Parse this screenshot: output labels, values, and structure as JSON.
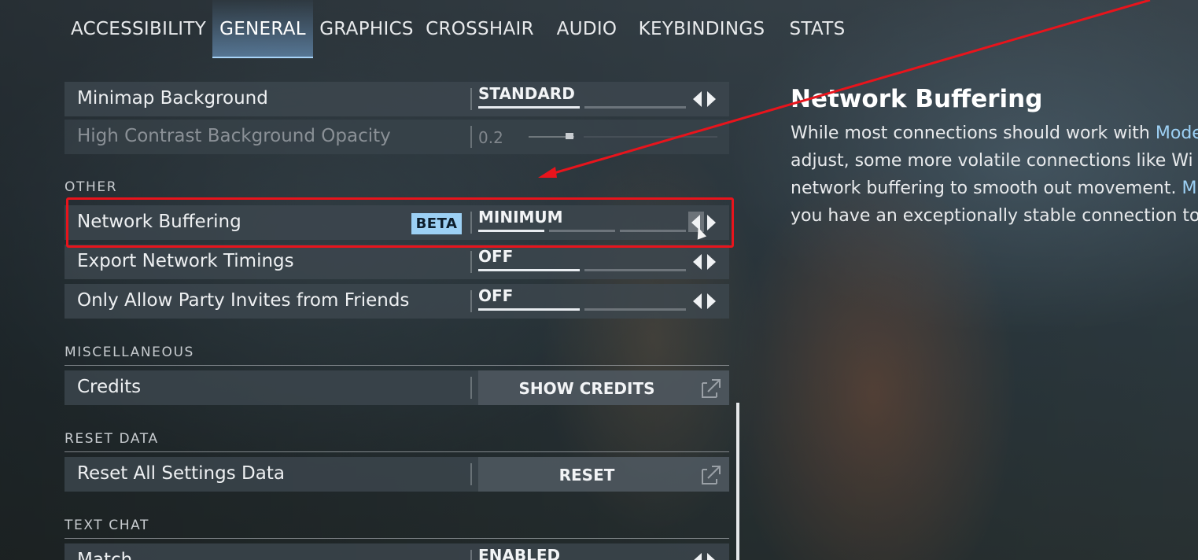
{
  "tabs": [
    {
      "label": "ACCESSIBILITY"
    },
    {
      "label": "GENERAL"
    },
    {
      "label": "GRAPHICS"
    },
    {
      "label": "CROSSHAIR"
    },
    {
      "label": "AUDIO"
    },
    {
      "label": "KEYBINDINGS"
    },
    {
      "label": "STATS"
    }
  ],
  "active_tab": "GENERAL",
  "settings": {
    "minimap_background": {
      "label": "Minimap Background",
      "value": "STANDARD",
      "options_count": 2,
      "selected_index": 1
    },
    "hc_opacity": {
      "label": "High Contrast Background Opacity",
      "value": "0.2",
      "slider_fraction": 0.2,
      "disabled": true
    },
    "other_section": "OTHER",
    "network_buffering": {
      "label": "Network Buffering",
      "badge": "BETA",
      "value": "MINIMUM",
      "options_count": 3,
      "selected_index": 1
    },
    "export_network_timings": {
      "label": "Export Network Timings",
      "value": "OFF",
      "options_count": 2,
      "selected_index": 1
    },
    "party_invites": {
      "label": "Only Allow Party Invites from Friends",
      "value": "OFF",
      "options_count": 2,
      "selected_index": 1
    },
    "misc_section": "MISCELLANEOUS",
    "credits": {
      "label": "Credits",
      "button": "SHOW CREDITS"
    },
    "reset_section": "RESET DATA",
    "reset_all": {
      "label": "Reset All Settings Data",
      "button": "RESET"
    },
    "text_chat_section": "TEXT CHAT",
    "match": {
      "label": "Match",
      "value": "ENABLED"
    }
  },
  "info": {
    "title": "Network Buffering",
    "line1_pre": "While most connections should work with ",
    "line1_hl": "Moderate",
    "line2_pre": "adjust, some more volatile connections like Wi",
    "line3_pre": "network buffering to smooth out movement. ",
    "line3_hl": "Minimum",
    "line4_pre": "you have an exceptionally stable connection to"
  },
  "colors": {
    "accent": "#9cd0f4",
    "annotation": "#e8141c",
    "row_bg": "#3e4850"
  }
}
